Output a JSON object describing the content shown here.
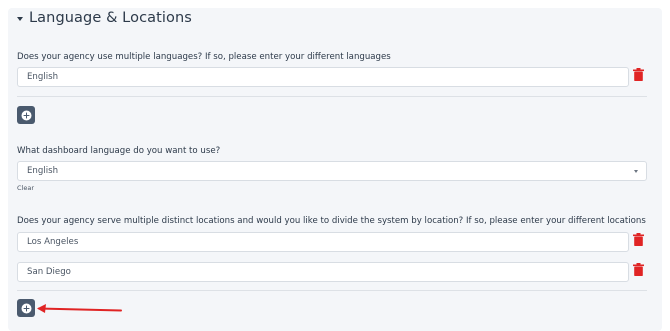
{
  "section": {
    "title": "Language & Locations"
  },
  "languages": {
    "question": "Does your agency use multiple languages? If so, please enter your different languages",
    "entries": [
      "English"
    ]
  },
  "dashboard_language": {
    "question": "What dashboard language do you want to use?",
    "selected": "English",
    "clear_label": "Clear"
  },
  "locations": {
    "question": "Does your agency serve multiple distinct locations and would you like to divide the system by location? If so, please enter your different locations",
    "entries": [
      "Los Angeles",
      "San Diego"
    ]
  },
  "colors": {
    "delete_icon": "#e02424",
    "add_button": "#4a5a6e",
    "annotation_arrow": "#e02424"
  }
}
